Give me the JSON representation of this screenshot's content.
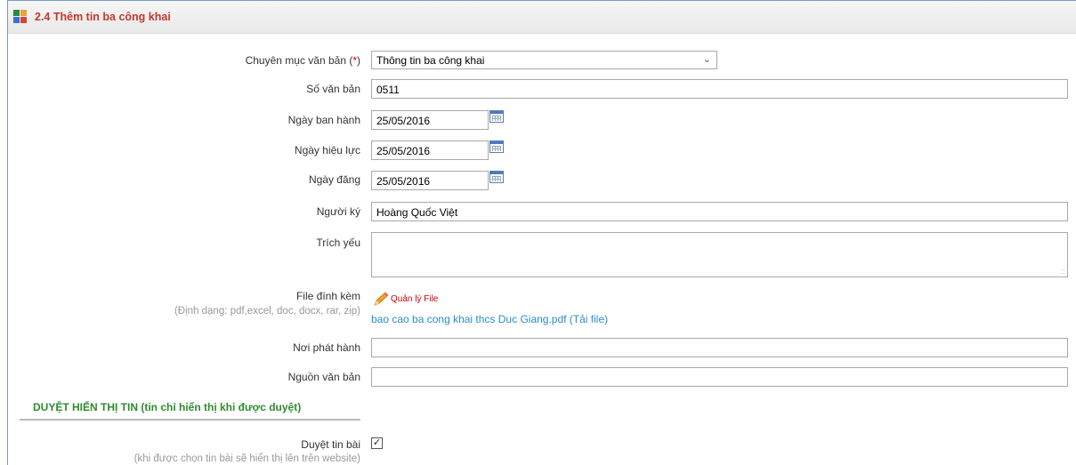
{
  "header": {
    "title": "2.4 Thêm tin ba công khai"
  },
  "form": {
    "category": {
      "label": "Chuyên mục văn bản (",
      "required_mark": "*",
      "label_end": ")",
      "value": "Thông tin ba công khai"
    },
    "doc_number": {
      "label": "Số văn bản",
      "value": "0511"
    },
    "issue_date": {
      "label": "Ngày ban hành",
      "value": "25/05/2016"
    },
    "effective_date": {
      "label": "Ngày hiệu lực",
      "value": "25/05/2016"
    },
    "post_date": {
      "label": "Ngày đăng",
      "value": "25/05/2016"
    },
    "signer": {
      "label": "Người ký",
      "value": "Hoàng Quốc Việt"
    },
    "summary": {
      "label": "Trích yếu",
      "value": ""
    },
    "attachment": {
      "label": "File đính kèm",
      "hint": "(Định dạng: pdf,excel, doc, docx, rar, zip)",
      "manage_label": "Quản lý File",
      "file_link": "bao cao ba cong khai thcs Duc Giang.pdf (Tải file)"
    },
    "issuer": {
      "label": "Nơi phát hành",
      "value": ""
    },
    "source": {
      "label": "Nguồn văn bản",
      "value": ""
    }
  },
  "approval": {
    "section_title": "DUYỆT HIỂN THỊ TIN (tin chỉ hiển thị khi được duyệt)",
    "approve_label": "Duyệt tin bài",
    "approve_hint": "(khi được chọn tin bài sẽ hiển thị lên trên website)",
    "approve_checked": true
  },
  "colors": {
    "title": "#c0392b",
    "section": "#2e8b2e",
    "link": "#2a8ccf",
    "required": "#cc0000"
  }
}
